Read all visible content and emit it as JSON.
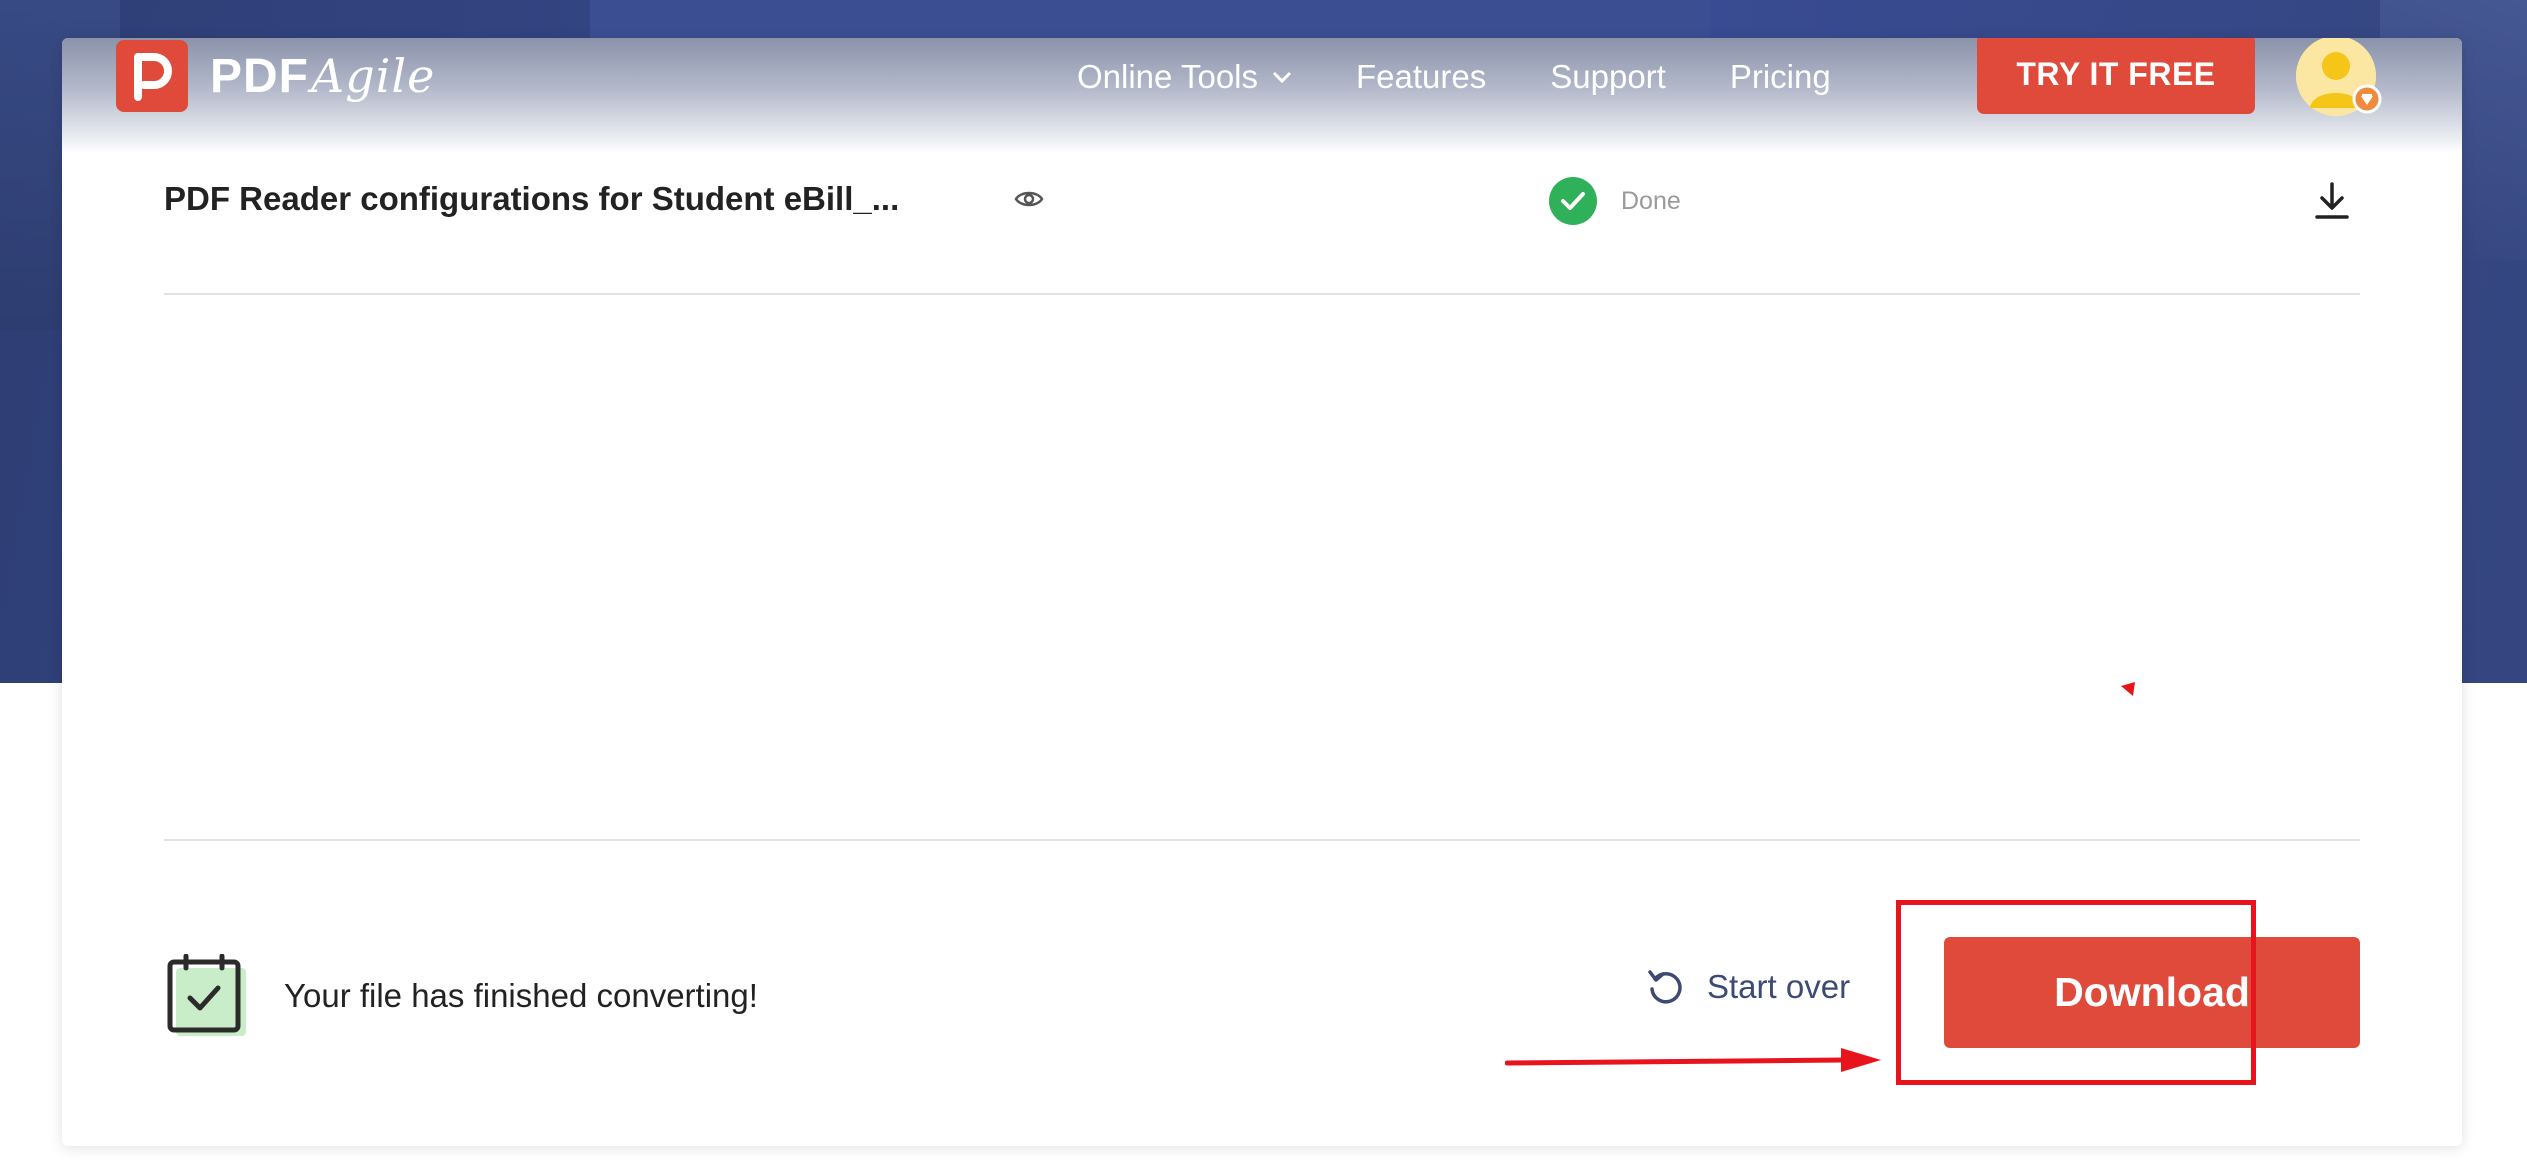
{
  "header": {
    "logo_text": "PDF",
    "logo_script": "Agile",
    "nav": [
      {
        "label": "Online Tools",
        "has_dropdown": true
      },
      {
        "label": "Features"
      },
      {
        "label": "Support"
      },
      {
        "label": "Pricing"
      }
    ],
    "cta_label": "TRY IT FREE"
  },
  "file": {
    "name": "PDF Reader configurations for Student eBill_...",
    "status": "Done"
  },
  "footer": {
    "message": "Your file has finished converting!",
    "start_over_label": "Start over",
    "download_label": "Download"
  },
  "colors": {
    "brand_red": "#e04a3b",
    "success_green": "#2fb15a",
    "annotation_red": "#e8141c",
    "hero_blue": "#36478a"
  }
}
